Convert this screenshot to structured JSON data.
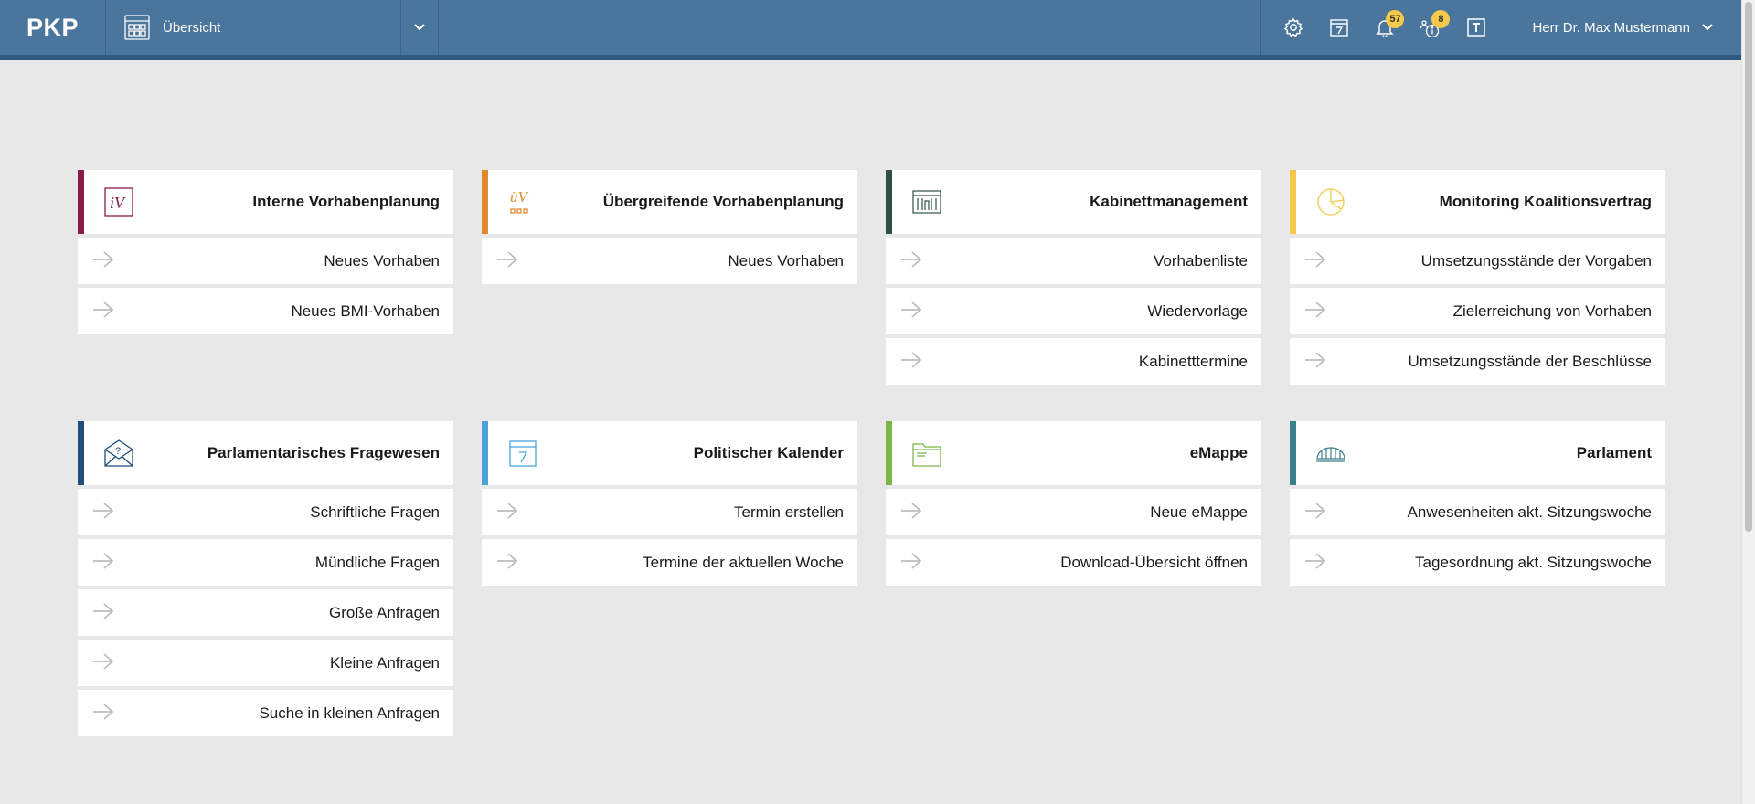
{
  "header": {
    "logo": "PKP",
    "module": "Übersicht",
    "notifications_count": "57",
    "info_count": "8",
    "user": "Herr Dr. Max Mustermann",
    "icons": [
      "gear-icon",
      "calendar-icon",
      "bell-icon",
      "people-info-icon",
      "text-icon"
    ]
  },
  "colors": {
    "header_bg": "#4a759c",
    "page_bg": "#e8e8e8",
    "badge": "#f5c94a"
  },
  "tiles": [
    {
      "title": "Interne Vorhabenplanung",
      "icon": "iv-icon",
      "accent": "#8a1c4a",
      "links": [
        "Neues Vorhaben",
        "Neues BMI-Vorhaben"
      ]
    },
    {
      "title": "Übergreifende Vorhabenplanung",
      "icon": "uev-icon",
      "accent": "#e08a2e",
      "links": [
        "Neues Vorhaben"
      ]
    },
    {
      "title": "Kabinettmanagement",
      "icon": "cabinet-building-icon",
      "accent": "#2f4f46",
      "links": [
        "Vorhabenliste",
        "Wiedervorlage",
        "Kabinetttermine"
      ]
    },
    {
      "title": "Monitoring Koalitionsvertrag",
      "icon": "pie-chart-icon",
      "accent": "#f2c94c",
      "links": [
        "Umsetzungsstände der Vorgaben",
        "Zielerreichung von Vorhaben",
        "Umsetzungsstände der Beschlüsse"
      ]
    },
    {
      "title": "Parlamentarisches Fragewesen",
      "icon": "question-envelope-icon",
      "accent": "#1f4e79",
      "links": [
        "Schriftliche Fragen",
        "Mündliche Fragen",
        "Große Anfragen",
        "Kleine Anfragen",
        "Suche in kleinen Anfragen"
      ]
    },
    {
      "title": "Politischer Kalender",
      "icon": "calendar-icon",
      "accent": "#4aa3d9",
      "links": [
        "Termin erstellen",
        "Termine der aktuellen Woche"
      ]
    },
    {
      "title": "eMappe",
      "icon": "folder-icon",
      "accent": "#7ab648",
      "links": [
        "Neue eMappe",
        "Download-Übersicht öffnen"
      ]
    },
    {
      "title": "Parlament",
      "icon": "parliament-dome-icon",
      "accent": "#3b7f8c",
      "links": [
        "Anwesenheiten akt. Sitzungswoche",
        "Tagesordnung akt. Sitzungswoche"
      ]
    }
  ]
}
